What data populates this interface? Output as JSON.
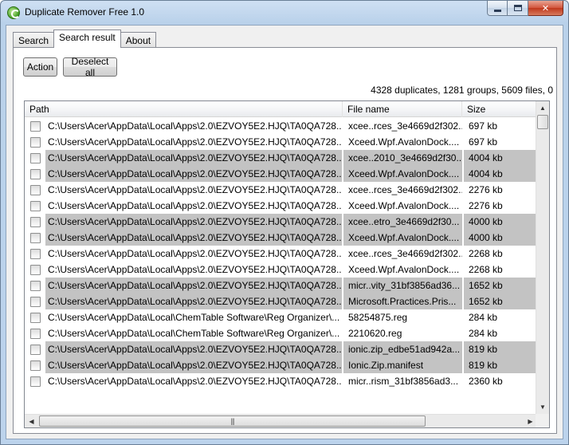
{
  "window": {
    "title": "Duplicate Remover Free 1.0"
  },
  "tabs": [
    {
      "label": "Search",
      "active": false
    },
    {
      "label": "Search result",
      "active": true
    },
    {
      "label": "About",
      "active": false
    }
  ],
  "toolbar": {
    "action_label": "Action",
    "deselect_label": "Deselect all"
  },
  "summary": "4328 duplicates, 1281 groups, 5609 files, 0",
  "table": {
    "columns": [
      "Path",
      "File name",
      "Size"
    ],
    "rows": [
      {
        "path": "C:\\Users\\Acer\\AppData\\Local\\Apps\\2.0\\EZVOY5E2.HJQ\\TA0QA728...",
        "name": "xcee..rces_3e4669d2f302...",
        "size": "697 kb",
        "grey": false
      },
      {
        "path": "C:\\Users\\Acer\\AppData\\Local\\Apps\\2.0\\EZVOY5E2.HJQ\\TA0QA728...",
        "name": "Xceed.Wpf.AvalonDock....",
        "size": "697 kb",
        "grey": false
      },
      {
        "path": "C:\\Users\\Acer\\AppData\\Local\\Apps\\2.0\\EZVOY5E2.HJQ\\TA0QA728...",
        "name": "xcee..2010_3e4669d2f30...",
        "size": "4004 kb",
        "grey": true
      },
      {
        "path": "C:\\Users\\Acer\\AppData\\Local\\Apps\\2.0\\EZVOY5E2.HJQ\\TA0QA728...",
        "name": "Xceed.Wpf.AvalonDock....",
        "size": "4004 kb",
        "grey": true
      },
      {
        "path": "C:\\Users\\Acer\\AppData\\Local\\Apps\\2.0\\EZVOY5E2.HJQ\\TA0QA728...",
        "name": "xcee..rces_3e4669d2f302...",
        "size": "2276 kb",
        "grey": false
      },
      {
        "path": "C:\\Users\\Acer\\AppData\\Local\\Apps\\2.0\\EZVOY5E2.HJQ\\TA0QA728...",
        "name": "Xceed.Wpf.AvalonDock....",
        "size": "2276 kb",
        "grey": false
      },
      {
        "path": "C:\\Users\\Acer\\AppData\\Local\\Apps\\2.0\\EZVOY5E2.HJQ\\TA0QA728...",
        "name": "xcee..etro_3e4669d2f30...",
        "size": "4000 kb",
        "grey": true
      },
      {
        "path": "C:\\Users\\Acer\\AppData\\Local\\Apps\\2.0\\EZVOY5E2.HJQ\\TA0QA728...",
        "name": "Xceed.Wpf.AvalonDock....",
        "size": "4000 kb",
        "grey": true
      },
      {
        "path": "C:\\Users\\Acer\\AppData\\Local\\Apps\\2.0\\EZVOY5E2.HJQ\\TA0QA728...",
        "name": "xcee..rces_3e4669d2f302...",
        "size": "2268 kb",
        "grey": false
      },
      {
        "path": "C:\\Users\\Acer\\AppData\\Local\\Apps\\2.0\\EZVOY5E2.HJQ\\TA0QA728...",
        "name": "Xceed.Wpf.AvalonDock....",
        "size": "2268 kb",
        "grey": false
      },
      {
        "path": "C:\\Users\\Acer\\AppData\\Local\\Apps\\2.0\\EZVOY5E2.HJQ\\TA0QA728...",
        "name": "micr..vity_31bf3856ad36...",
        "size": "1652 kb",
        "grey": true
      },
      {
        "path": "C:\\Users\\Acer\\AppData\\Local\\Apps\\2.0\\EZVOY5E2.HJQ\\TA0QA728...",
        "name": "Microsoft.Practices.Pris...",
        "size": "1652 kb",
        "grey": true
      },
      {
        "path": "C:\\Users\\Acer\\AppData\\Local\\ChemTable Software\\Reg Organizer\\...",
        "name": "58254875.reg",
        "size": "284 kb",
        "grey": false
      },
      {
        "path": "C:\\Users\\Acer\\AppData\\Local\\ChemTable Software\\Reg Organizer\\...",
        "name": "2210620.reg",
        "size": "284 kb",
        "grey": false
      },
      {
        "path": "C:\\Users\\Acer\\AppData\\Local\\Apps\\2.0\\EZVOY5E2.HJQ\\TA0QA728...",
        "name": "ionic.zip_edbe51ad942a...",
        "size": "819 kb",
        "grey": true
      },
      {
        "path": "C:\\Users\\Acer\\AppData\\Local\\Apps\\2.0\\EZVOY5E2.HJQ\\TA0QA728...",
        "name": "Ionic.Zip.manifest",
        "size": "819 kb",
        "grey": true
      },
      {
        "path": "C:\\Users\\Acer\\AppData\\Local\\Apps\\2.0\\EZVOY5E2.HJQ\\TA0QA728...",
        "name": "micr..rism_31bf3856ad3...",
        "size": "2360 kb",
        "grey": false
      }
    ]
  },
  "icons": {
    "app": "app-recycle-icon",
    "minimize": "minimize-icon",
    "maximize": "maximize-icon",
    "close": "close-icon"
  },
  "colors": {
    "row_grey": "#c3c3c3",
    "title_bar": "#b9d1ea",
    "close": "#c0381c"
  }
}
